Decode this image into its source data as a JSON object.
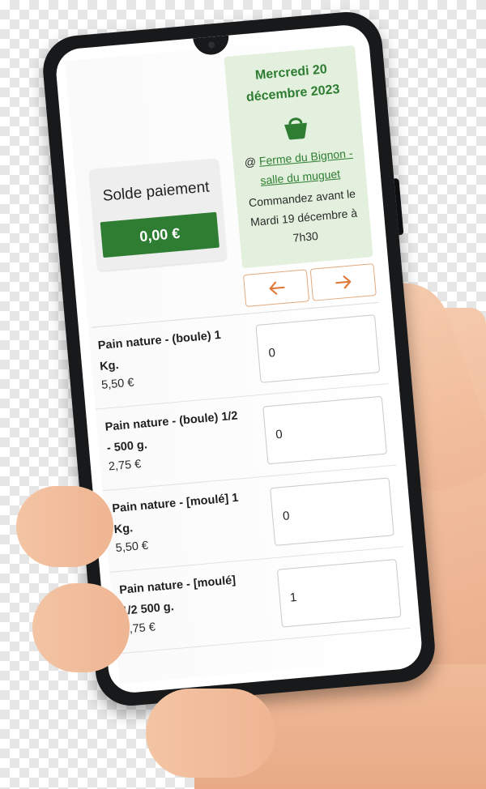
{
  "balance": {
    "label": "Solde paiement",
    "amount": "0,00 €"
  },
  "delivery": {
    "date": "Mercredi 20 décembre 2023",
    "icon": "basket-icon",
    "place_prefix": "@",
    "place_name": "Ferme du Bignon - salle du muguet",
    "deadline": "Commandez avant le Mardi 19 décembre à 7h30"
  },
  "navigation": {
    "prev_icon": "arrow-left-icon",
    "next_icon": "arrow-right-icon"
  },
  "products": [
    {
      "name": "Pain nature - (boule) 1 Kg.",
      "price": "5,50 €",
      "quantity": "0"
    },
    {
      "name": "Pain nature - (boule) 1/2 - 500 g.",
      "price": "2,75 €",
      "quantity": "0"
    },
    {
      "name": "Pain nature - [moulé] 1 Kg.",
      "price": "5,50 €",
      "quantity": "0"
    },
    {
      "name": "Pain nature - [moulé] 1/2 500 g.",
      "price": "2,75 €",
      "quantity": "1"
    }
  ],
  "colors": {
    "accent_green": "#2e7d32",
    "card_green_bg": "#e3f0dd",
    "arrow_orange": "#e07a3a"
  }
}
